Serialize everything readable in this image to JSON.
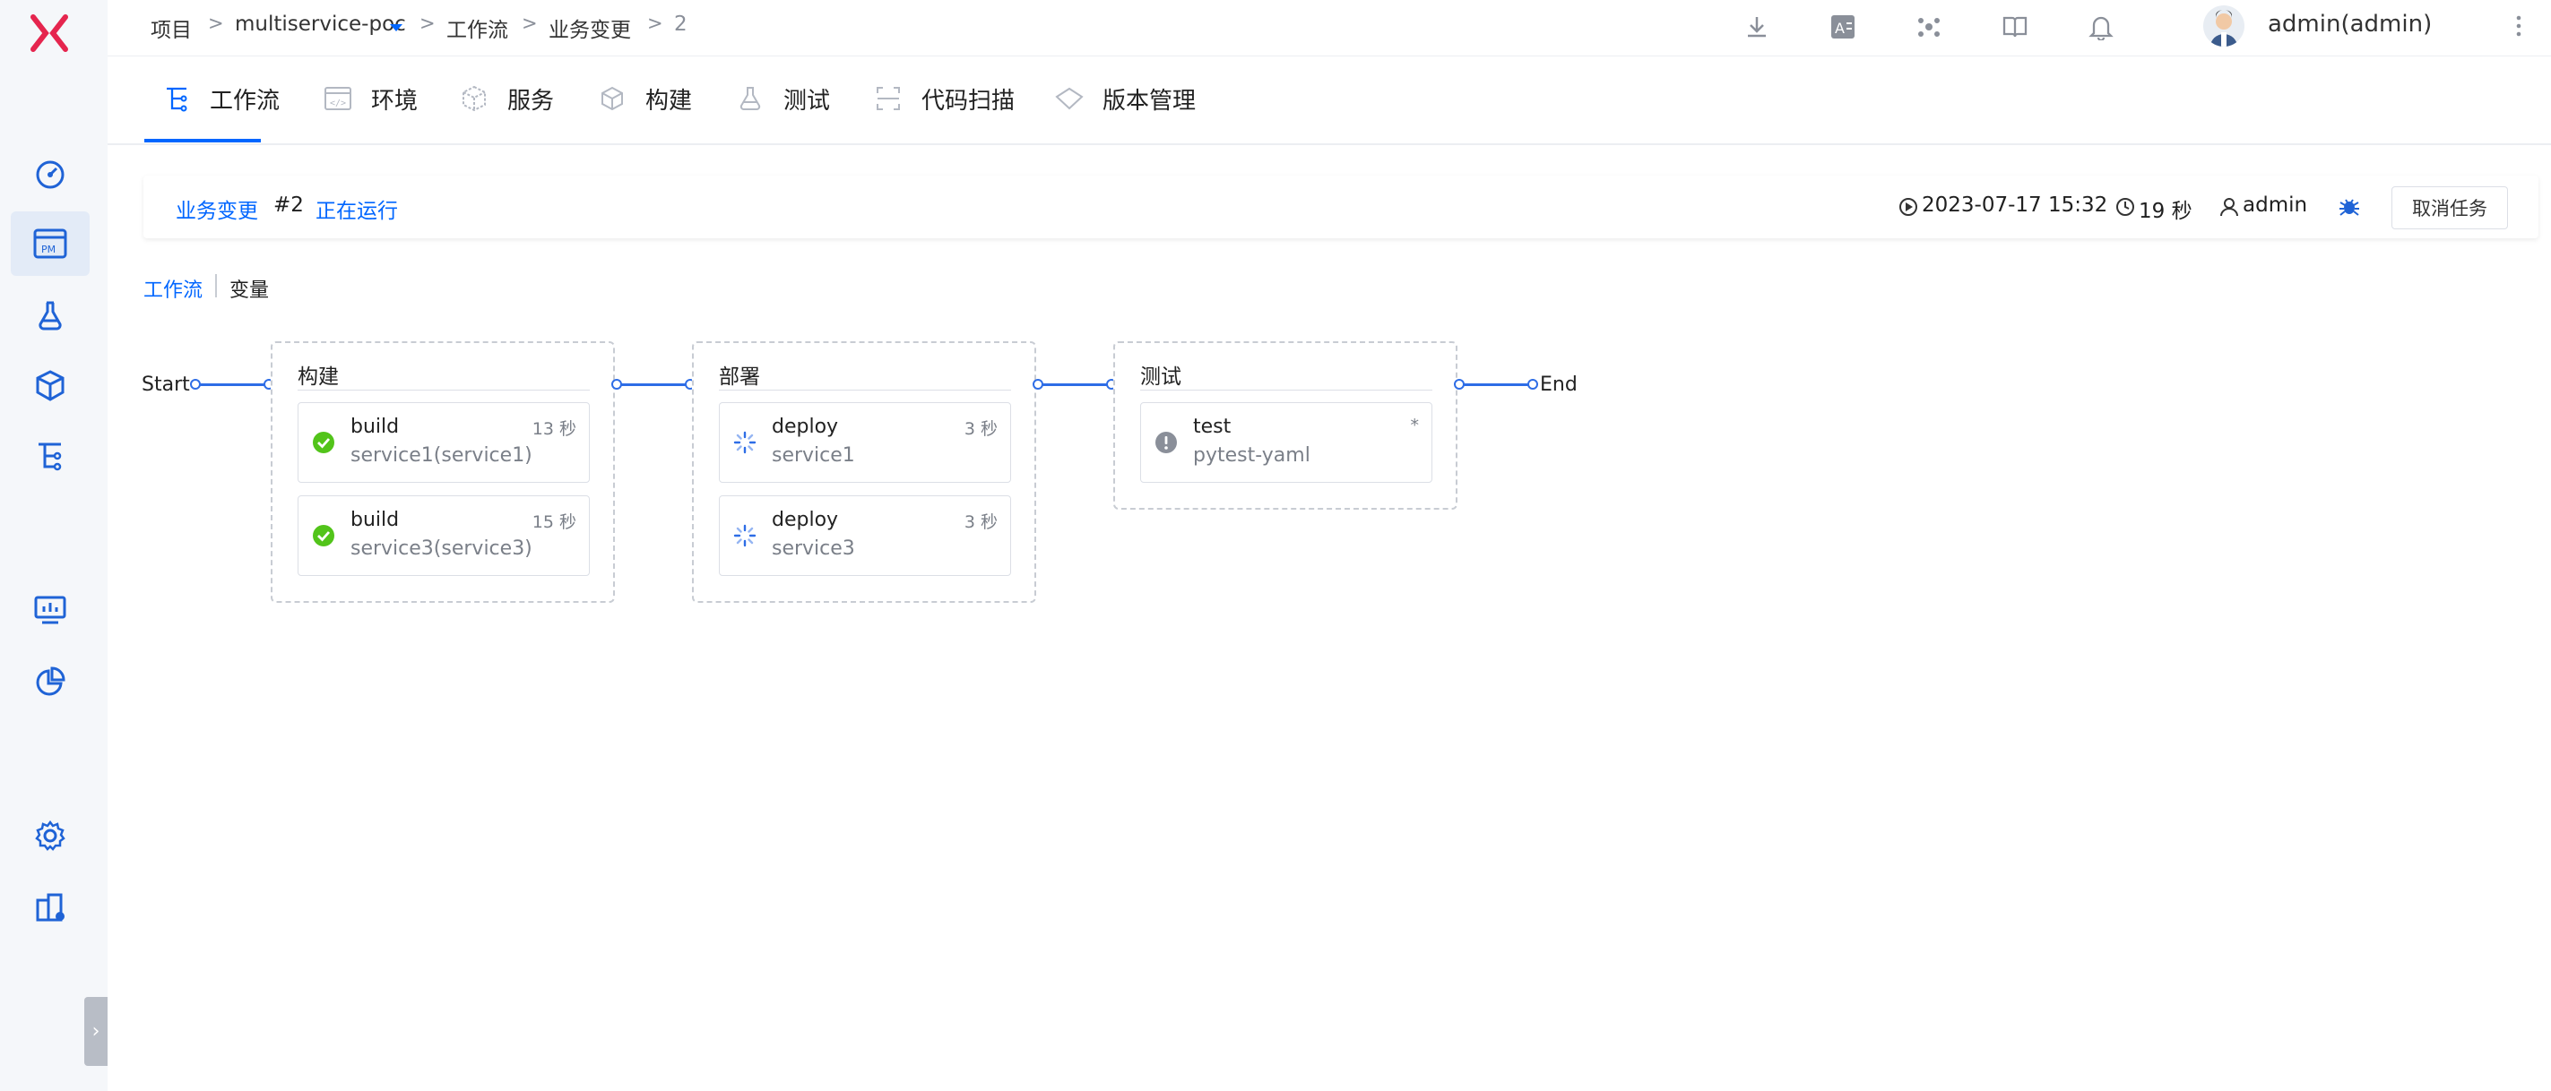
{
  "breadcrumb": {
    "project": "项目",
    "sep": ">",
    "project_name": "multiservice-poc",
    "workflow": "工作流",
    "workflow_name": "业务变更",
    "run_number": "2"
  },
  "user": {
    "display": "admin(admin)"
  },
  "tabs": [
    {
      "label": "工作流",
      "icon": "workflow-icon"
    },
    {
      "label": "环境",
      "icon": "code-window-icon"
    },
    {
      "label": "服务",
      "icon": "cube-icon"
    },
    {
      "label": "构建",
      "icon": "hexagon-icon"
    },
    {
      "label": "测试",
      "icon": "flask-icon"
    },
    {
      "label": "代码扫描",
      "icon": "scan-icon"
    },
    {
      "label": "版本管理",
      "icon": "diamond-icon"
    }
  ],
  "task": {
    "workflow_name": "业务变更",
    "run": "#2",
    "status": "正在运行",
    "start_time": "2023-07-17 15:32",
    "duration": "19 秒",
    "user": "admin",
    "cancel_label": "取消任务"
  },
  "subtabs": {
    "workflow": "工作流",
    "variables": "变量"
  },
  "pipeline": {
    "start": "Start",
    "end": "End",
    "stages": [
      {
        "title": "构建",
        "jobs": [
          {
            "name": "build",
            "target": "service1(service1)",
            "time": "13 秒",
            "status": "success"
          },
          {
            "name": "build",
            "target": "service3(service3)",
            "time": "15 秒",
            "status": "success"
          }
        ]
      },
      {
        "title": "部署",
        "jobs": [
          {
            "name": "deploy",
            "target": "service1",
            "time": "3 秒",
            "status": "running"
          },
          {
            "name": "deploy",
            "target": "service3",
            "time": "3 秒",
            "status": "running"
          }
        ]
      },
      {
        "title": "测试",
        "jobs": [
          {
            "name": "test",
            "target": "pytest-yaml",
            "time": "*",
            "status": "pending"
          }
        ]
      }
    ]
  },
  "colors": {
    "accent": "#0066ff",
    "success": "#52c41a",
    "pending": "#8a8f99",
    "logo": "#e5254e"
  }
}
